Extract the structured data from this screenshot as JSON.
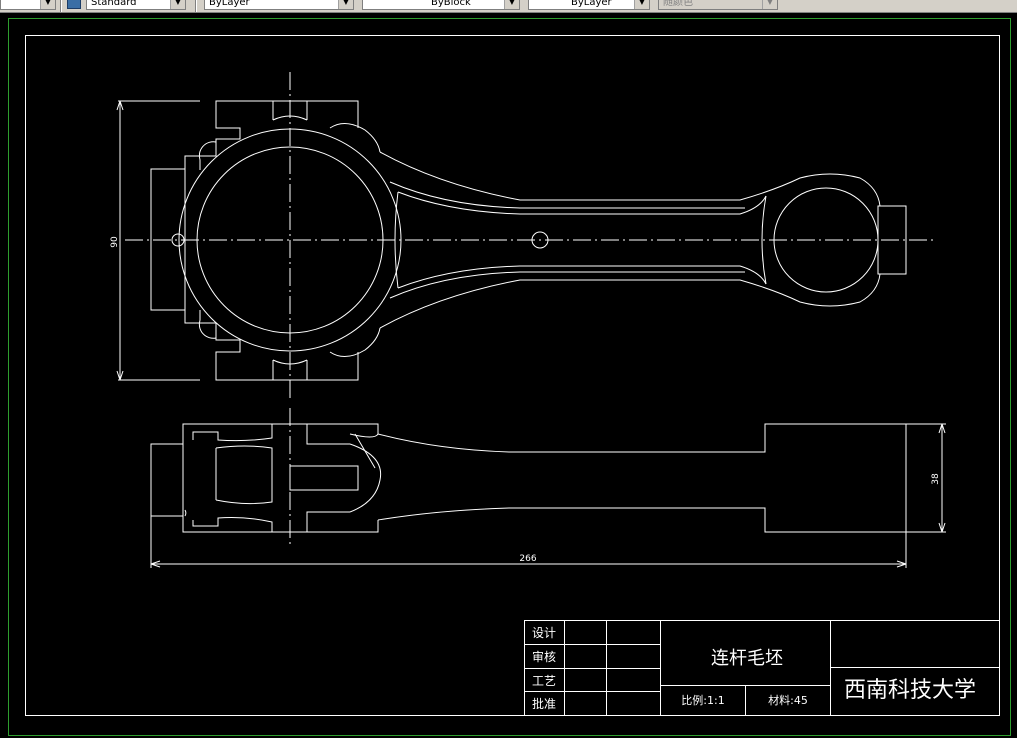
{
  "toolbar": {
    "text_style": "Standard",
    "layer": "ByLayer",
    "linetype": "ByBlock",
    "lineweight": "ByLayer",
    "plot_style": "随颜色"
  },
  "drawing": {
    "dim_height": "90",
    "dim_thickness": "38",
    "dim_length": "266"
  },
  "title_block": {
    "row_labels": [
      "设计",
      "审核",
      "工艺",
      "批准"
    ],
    "part_name": "连杆毛坯",
    "scale": "比例:1:1",
    "material": "材料:45",
    "organization": "西南科技大学"
  },
  "colors": {
    "background": "#000000",
    "line": "#ffffff",
    "viewport_border": "#2e9e2e"
  }
}
